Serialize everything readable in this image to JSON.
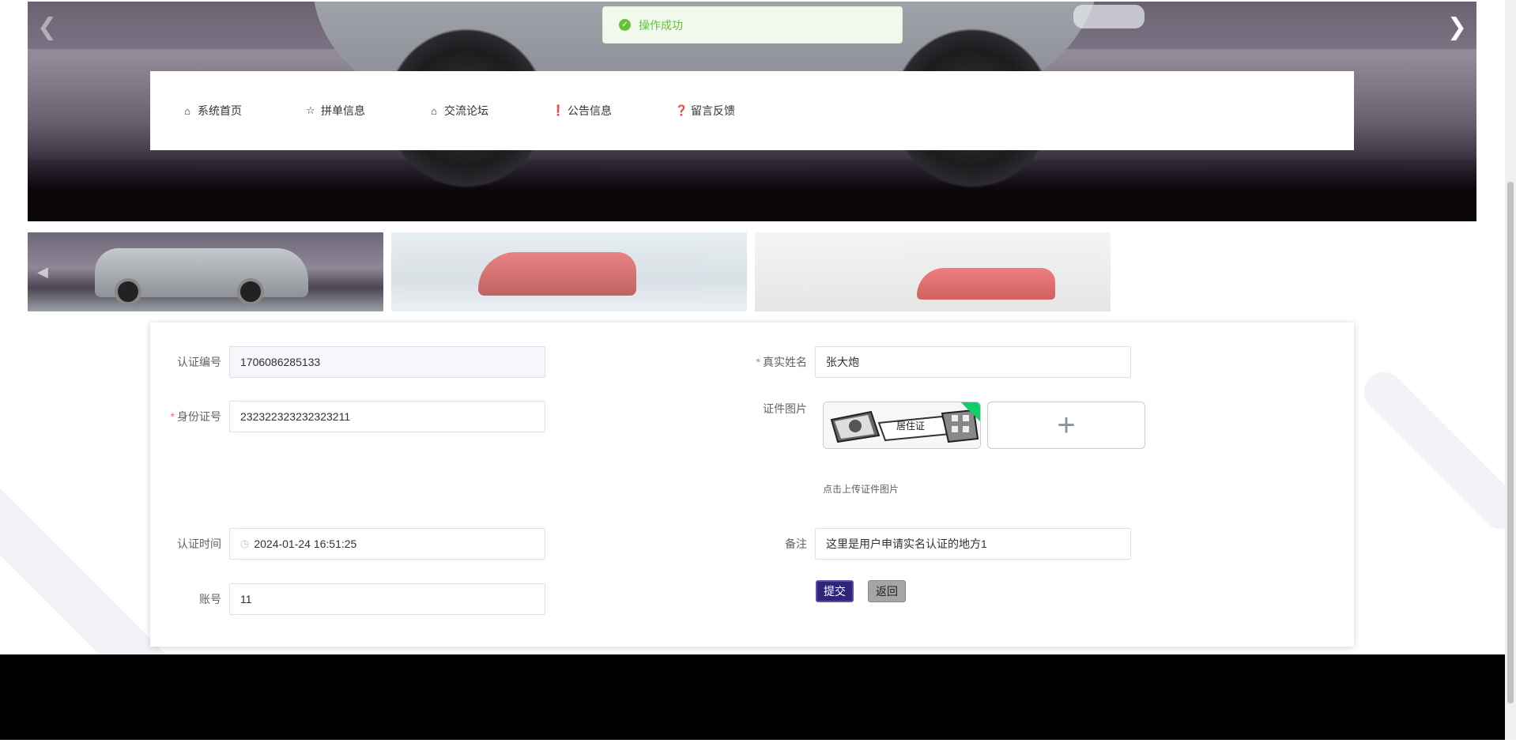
{
  "toast": {
    "message": "操作成功"
  },
  "nav": {
    "items": [
      {
        "label": "系统首页",
        "icon": "home-icon"
      },
      {
        "label": "拼单信息",
        "icon": "star-icon"
      },
      {
        "label": "交流论坛",
        "icon": "bag-icon"
      },
      {
        "label": "公告信息",
        "icon": "exclamation-circle-icon"
      },
      {
        "label": "留言反馈",
        "icon": "question-circle-icon"
      }
    ]
  },
  "form": {
    "cert_no_label": "认证编号",
    "cert_no_value": "1706086285133",
    "id_no_label": "身份证号",
    "id_no_value": "232322323232323211",
    "cert_time_label": "认证时间",
    "cert_time_value": "2024-01-24 16:51:25",
    "account_label": "账号",
    "account_value": "11",
    "real_name_label": "真实姓名",
    "real_name_value": "张大炮",
    "cert_image_label": "证件图片",
    "upload_tip": "点击上传证件图片",
    "image_stamp": "居住证",
    "remark_label": "备注",
    "remark_value": "这里是用户申请实名认证的地方1",
    "required_mark": "*"
  },
  "buttons": {
    "submit": "提交",
    "back": "返回"
  },
  "colors": {
    "primary": "#2f2679",
    "success": "#67c23a",
    "required": "#f56c6c"
  }
}
